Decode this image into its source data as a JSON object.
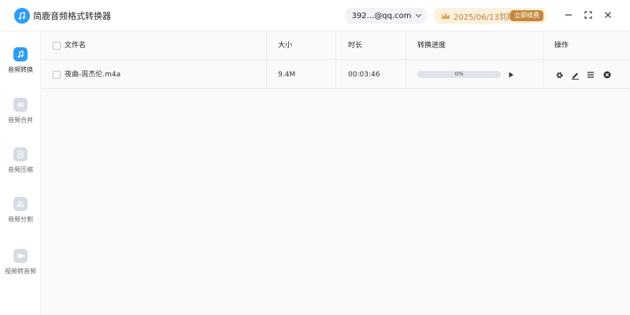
{
  "app": {
    "title": "简鹿音频格式转换器",
    "account": "392...@qq.com",
    "vip_expiry": "2025/06/13到期",
    "renew_label": "立即续费"
  },
  "sidebar": {
    "items": [
      {
        "label": "音频转换",
        "icon": "music-note-icon",
        "active": true
      },
      {
        "label": "音频合并",
        "icon": "audio-merge-icon",
        "active": false
      },
      {
        "label": "音频压缩",
        "icon": "audio-compress-icon",
        "active": false
      },
      {
        "label": "音频分割",
        "icon": "scissors-icon",
        "active": false
      },
      {
        "label": "视频转音频",
        "icon": "video-camera-icon",
        "active": false
      }
    ]
  },
  "table": {
    "headers": {
      "filename": "文件名",
      "size": "大小",
      "duration": "时长",
      "progress": "转换进度",
      "actions": "操作"
    },
    "rows": [
      {
        "filename": "夜曲-周杰伦.m4a",
        "size": "9.4M",
        "duration": "00:03:46",
        "progress": 0,
        "progress_label": "0%"
      }
    ]
  },
  "colors": {
    "accent": "#2e9cf3",
    "vip_bg": "#fdf0dc",
    "vip_text": "#b7803d",
    "renew_bg": "#c4883e"
  }
}
